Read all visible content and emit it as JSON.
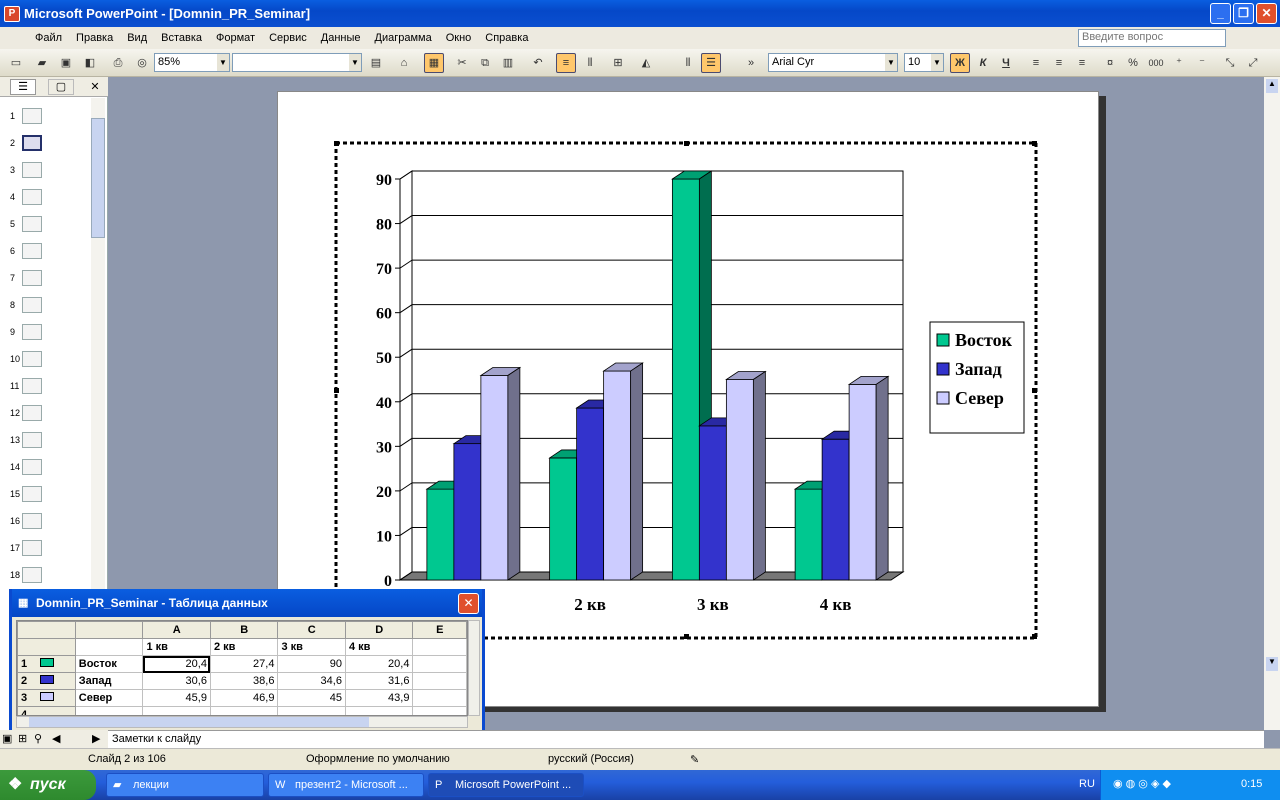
{
  "window": {
    "title": "Microsoft PowerPoint - [Domnin_PR_Seminar]",
    "min": "_",
    "restore": "❐",
    "close": "✕"
  },
  "menu": {
    "items": [
      "Файл",
      "Правка",
      "Вид",
      "Вставка",
      "Формат",
      "Сервис",
      "Данные",
      "Диаграмма",
      "Окно",
      "Справка"
    ],
    "ask_placeholder": "Введите вопрос"
  },
  "toolbar": {
    "zoom": "85%",
    "font": "Arial Cyr",
    "size": "10",
    "bold": "Ж",
    "italic": "К",
    "underline": "Ч",
    "percent": "%",
    "thousands": "000"
  },
  "left_pane": {
    "slide_numbers": [
      "1",
      "2",
      "3",
      "4",
      "5",
      "6",
      "7",
      "8",
      "9",
      "10",
      "11",
      "12",
      "13",
      "14",
      "15",
      "16",
      "17",
      "18"
    ],
    "selected": "2"
  },
  "chart_data": {
    "type": "bar",
    "categories": [
      "1 кв",
      "2 кв",
      "3 кв",
      "4 кв"
    ],
    "series": [
      {
        "name": "Восток",
        "values": [
          20.4,
          27.4,
          90,
          20.4
        ],
        "color": "#00c890"
      },
      {
        "name": "Запад",
        "values": [
          30.6,
          38.6,
          34.6,
          31.6
        ],
        "color": "#3333cc"
      },
      {
        "name": "Север",
        "values": [
          45.9,
          46.9,
          45,
          43.9
        ],
        "color": "#ccccff"
      }
    ],
    "ylim": [
      0,
      90
    ],
    "yticks": [
      "0",
      "10",
      "20",
      "30",
      "40",
      "50",
      "60",
      "70",
      "80",
      "90"
    ],
    "grid": true,
    "legend": "right",
    "style": "3d-clustered-column"
  },
  "datasheet": {
    "title": "Domnin_PR_Seminar - Таблица данных",
    "columns": [
      "",
      "A",
      "B",
      "C",
      "D",
      "E"
    ],
    "header_row": [
      "",
      "1 кв",
      "2 кв",
      "3 кв",
      "4 кв",
      ""
    ],
    "rows": [
      {
        "num": "1",
        "label": "Восток",
        "values": [
          "20,4",
          "27,4",
          "90",
          "20,4"
        ]
      },
      {
        "num": "2",
        "label": "Запад",
        "values": [
          "30,6",
          "38,6",
          "34,6",
          "31,6"
        ]
      },
      {
        "num": "3",
        "label": "Север",
        "values": [
          "45,9",
          "46,9",
          "45",
          "43,9"
        ]
      },
      {
        "num": "4",
        "label": "",
        "values": [
          "",
          "",
          "",
          ""
        ]
      }
    ],
    "close": "✕"
  },
  "notes": {
    "text": "Заметки к слайду"
  },
  "status": {
    "slide": "Слайд 2 из 106",
    "design": "Оформление по умолчанию",
    "lang": "русский (Россия)"
  },
  "taskbar": {
    "start": "пуск",
    "tasks": [
      "лекции",
      "презент2 - Microsoft ...",
      "Microsoft PowerPoint ..."
    ],
    "lang": "RU",
    "clock": "0:15"
  }
}
